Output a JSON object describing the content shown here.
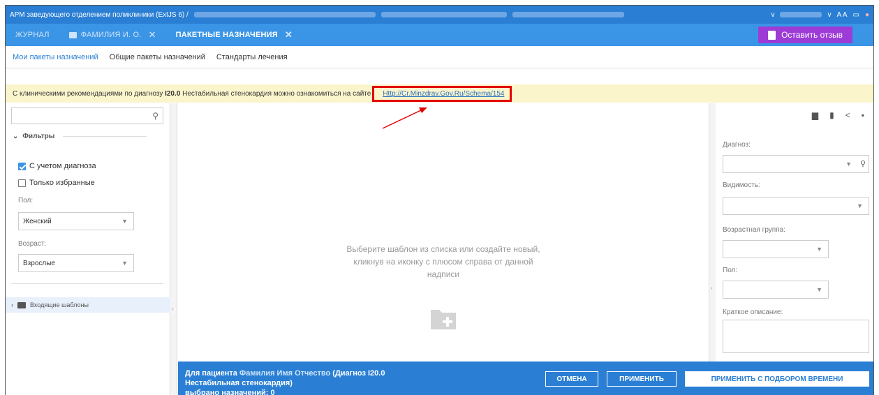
{
  "window": {
    "title": "АРМ заведующего отделением поликлиники (ExtJS 6) /",
    "controls": {
      "dropdown": "v",
      "font_size": "A A"
    }
  },
  "tabs": [
    {
      "label": "ЖУРНАЛ",
      "active": false,
      "closable": false
    },
    {
      "label": "ФАМИЛИЯ И. О.",
      "active": false,
      "closable": true
    },
    {
      "label": "ПАКЕТНЫЕ НАЗНАЧЕНИЯ",
      "active": true,
      "closable": true
    }
  ],
  "feedback_button": "Оставить отзыв",
  "subtabs": [
    {
      "label": "Мои пакеты назначений",
      "active": true
    },
    {
      "label": "Общие пакеты назначений",
      "active": false
    },
    {
      "label": "Стандарты лечения",
      "active": false
    }
  ],
  "banner": {
    "prefix": "С клиническими рекомендациями по диагнозу",
    "code": "I20.0",
    "middle": "Нестабильная стенокардия можно ознакомиться на сайте",
    "link": "Http://Cr.Minzdrav.Gov.Ru/Schema/154"
  },
  "left": {
    "search_placeholder": "",
    "filters_title": "Фильтры",
    "checkbox_diagnosis": {
      "label": "С учетом диагноза",
      "checked": true
    },
    "checkbox_favorites": {
      "label": "Только избранные",
      "checked": false
    },
    "sex_label": "Пол:",
    "sex_value": "Женский",
    "age_label": "Возраст:",
    "age_value": "Взрослые",
    "tree_item": "Входящие шаблоны"
  },
  "center": {
    "empty_message": "Выберите шаблон из списка или создайте новый, кликнув на иконку с плюсом справа от данной надписи"
  },
  "right": {
    "diagnosis_label": "Диагноз:",
    "visibility_label": "Видимость:",
    "age_group_label": "Возрастная группа:",
    "sex_label": "Пол:",
    "description_label": "Краткое описание:"
  },
  "bottom": {
    "line1_prefix": "Для пациента",
    "patient_name": "Фамилия Имя Отчество",
    "line1_suffix": "(Диагноз I20.0 Нестабильная стенокардия)",
    "line2": "выбрано назначений: 0",
    "cancel": "ОТМЕНА",
    "apply": "ПРИМЕНИТЬ",
    "apply_time": "ПРИМЕНИТЬ С ПОДБОРОМ ВРЕМЕНИ"
  },
  "colors": {
    "header_blue": "#2a7fd4",
    "tab_blue": "#3b95e6",
    "feedback_purple": "#9c3bd6",
    "banner_yellow": "#fbf5cc",
    "highlight_red": "#e30000"
  }
}
